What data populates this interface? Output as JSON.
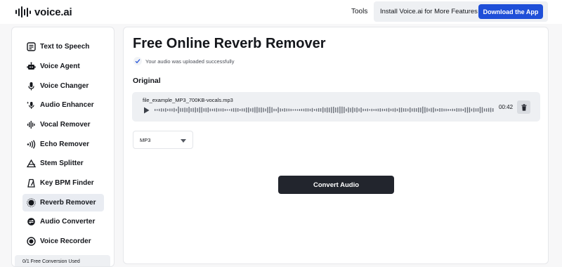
{
  "header": {
    "logo_text": "voice.ai",
    "logo_icon": "waveform-logo-icon",
    "tools_label": "Tools",
    "install_text": "Install Voice.ai for More Features",
    "download_label": "Download the App",
    "accent_color": "#1f4fd8"
  },
  "sidebar": {
    "items": [
      {
        "label": "Text to Speech",
        "icon": "text-speech-icon"
      },
      {
        "label": "Voice Agent",
        "icon": "robot-icon"
      },
      {
        "label": "Voice Changer",
        "icon": "microphone-icon"
      },
      {
        "label": "Audio Enhancer",
        "icon": "mic-sparkle-icon"
      },
      {
        "label": "Vocal Remover",
        "icon": "vocal-waveform-icon"
      },
      {
        "label": "Echo Remover",
        "icon": "echo-waves-icon"
      },
      {
        "label": "Stem Splitter",
        "icon": "split-triangle-icon"
      },
      {
        "label": "Key BPM Finder",
        "icon": "metronome-icon"
      },
      {
        "label": "Reverb Remover",
        "icon": "reverb-circle-icon",
        "active": true
      },
      {
        "label": "Audio Converter",
        "icon": "converter-icon"
      },
      {
        "label": "Voice Recorder",
        "icon": "record-icon"
      }
    ],
    "free_conversion_text": "0/1 Free Conversion Used"
  },
  "main": {
    "title": "Free Online Reverb Remover",
    "upload_status": "Your audio was uploaded successfully",
    "section_label": "Original",
    "player": {
      "file_name": "file_example_MP3_700KB-vocals.mp3",
      "duration": "00:42",
      "play_icon": "play-icon",
      "delete_icon": "trash-icon"
    },
    "format_select": {
      "selected": "MP3",
      "icon": "chevron-down-icon"
    },
    "convert_label": "Convert Audio"
  }
}
